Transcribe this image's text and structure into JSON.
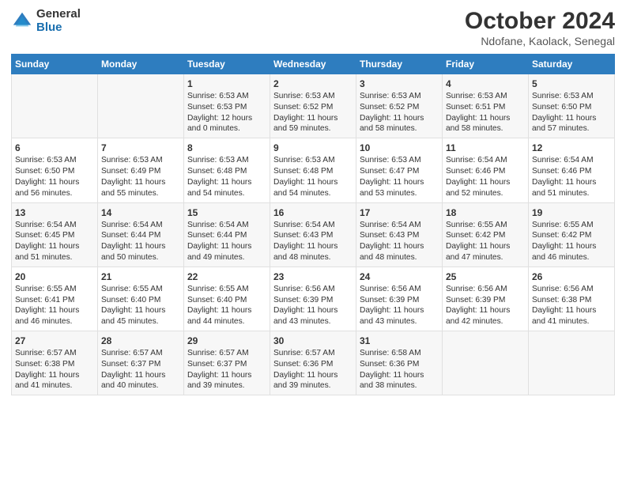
{
  "header": {
    "logo": {
      "general": "General",
      "blue": "Blue"
    },
    "title": "October 2024",
    "subtitle": "Ndofane, Kaolack, Senegal"
  },
  "days_of_week": [
    "Sunday",
    "Monday",
    "Tuesday",
    "Wednesday",
    "Thursday",
    "Friday",
    "Saturday"
  ],
  "weeks": [
    [
      {
        "day": "",
        "content": ""
      },
      {
        "day": "",
        "content": ""
      },
      {
        "day": "1",
        "content": "Sunrise: 6:53 AM\nSunset: 6:53 PM\nDaylight: 12 hours\nand 0 minutes."
      },
      {
        "day": "2",
        "content": "Sunrise: 6:53 AM\nSunset: 6:52 PM\nDaylight: 11 hours\nand 59 minutes."
      },
      {
        "day": "3",
        "content": "Sunrise: 6:53 AM\nSunset: 6:52 PM\nDaylight: 11 hours\nand 58 minutes."
      },
      {
        "day": "4",
        "content": "Sunrise: 6:53 AM\nSunset: 6:51 PM\nDaylight: 11 hours\nand 58 minutes."
      },
      {
        "day": "5",
        "content": "Sunrise: 6:53 AM\nSunset: 6:50 PM\nDaylight: 11 hours\nand 57 minutes."
      }
    ],
    [
      {
        "day": "6",
        "content": "Sunrise: 6:53 AM\nSunset: 6:50 PM\nDaylight: 11 hours\nand 56 minutes."
      },
      {
        "day": "7",
        "content": "Sunrise: 6:53 AM\nSunset: 6:49 PM\nDaylight: 11 hours\nand 55 minutes."
      },
      {
        "day": "8",
        "content": "Sunrise: 6:53 AM\nSunset: 6:48 PM\nDaylight: 11 hours\nand 54 minutes."
      },
      {
        "day": "9",
        "content": "Sunrise: 6:53 AM\nSunset: 6:48 PM\nDaylight: 11 hours\nand 54 minutes."
      },
      {
        "day": "10",
        "content": "Sunrise: 6:53 AM\nSunset: 6:47 PM\nDaylight: 11 hours\nand 53 minutes."
      },
      {
        "day": "11",
        "content": "Sunrise: 6:54 AM\nSunset: 6:46 PM\nDaylight: 11 hours\nand 52 minutes."
      },
      {
        "day": "12",
        "content": "Sunrise: 6:54 AM\nSunset: 6:46 PM\nDaylight: 11 hours\nand 51 minutes."
      }
    ],
    [
      {
        "day": "13",
        "content": "Sunrise: 6:54 AM\nSunset: 6:45 PM\nDaylight: 11 hours\nand 51 minutes."
      },
      {
        "day": "14",
        "content": "Sunrise: 6:54 AM\nSunset: 6:44 PM\nDaylight: 11 hours\nand 50 minutes."
      },
      {
        "day": "15",
        "content": "Sunrise: 6:54 AM\nSunset: 6:44 PM\nDaylight: 11 hours\nand 49 minutes."
      },
      {
        "day": "16",
        "content": "Sunrise: 6:54 AM\nSunset: 6:43 PM\nDaylight: 11 hours\nand 48 minutes."
      },
      {
        "day": "17",
        "content": "Sunrise: 6:54 AM\nSunset: 6:43 PM\nDaylight: 11 hours\nand 48 minutes."
      },
      {
        "day": "18",
        "content": "Sunrise: 6:55 AM\nSunset: 6:42 PM\nDaylight: 11 hours\nand 47 minutes."
      },
      {
        "day": "19",
        "content": "Sunrise: 6:55 AM\nSunset: 6:42 PM\nDaylight: 11 hours\nand 46 minutes."
      }
    ],
    [
      {
        "day": "20",
        "content": "Sunrise: 6:55 AM\nSunset: 6:41 PM\nDaylight: 11 hours\nand 46 minutes."
      },
      {
        "day": "21",
        "content": "Sunrise: 6:55 AM\nSunset: 6:40 PM\nDaylight: 11 hours\nand 45 minutes."
      },
      {
        "day": "22",
        "content": "Sunrise: 6:55 AM\nSunset: 6:40 PM\nDaylight: 11 hours\nand 44 minutes."
      },
      {
        "day": "23",
        "content": "Sunrise: 6:56 AM\nSunset: 6:39 PM\nDaylight: 11 hours\nand 43 minutes."
      },
      {
        "day": "24",
        "content": "Sunrise: 6:56 AM\nSunset: 6:39 PM\nDaylight: 11 hours\nand 43 minutes."
      },
      {
        "day": "25",
        "content": "Sunrise: 6:56 AM\nSunset: 6:39 PM\nDaylight: 11 hours\nand 42 minutes."
      },
      {
        "day": "26",
        "content": "Sunrise: 6:56 AM\nSunset: 6:38 PM\nDaylight: 11 hours\nand 41 minutes."
      }
    ],
    [
      {
        "day": "27",
        "content": "Sunrise: 6:57 AM\nSunset: 6:38 PM\nDaylight: 11 hours\nand 41 minutes."
      },
      {
        "day": "28",
        "content": "Sunrise: 6:57 AM\nSunset: 6:37 PM\nDaylight: 11 hours\nand 40 minutes."
      },
      {
        "day": "29",
        "content": "Sunrise: 6:57 AM\nSunset: 6:37 PM\nDaylight: 11 hours\nand 39 minutes."
      },
      {
        "day": "30",
        "content": "Sunrise: 6:57 AM\nSunset: 6:36 PM\nDaylight: 11 hours\nand 39 minutes."
      },
      {
        "day": "31",
        "content": "Sunrise: 6:58 AM\nSunset: 6:36 PM\nDaylight: 11 hours\nand 38 minutes."
      },
      {
        "day": "",
        "content": ""
      },
      {
        "day": "",
        "content": ""
      }
    ]
  ]
}
